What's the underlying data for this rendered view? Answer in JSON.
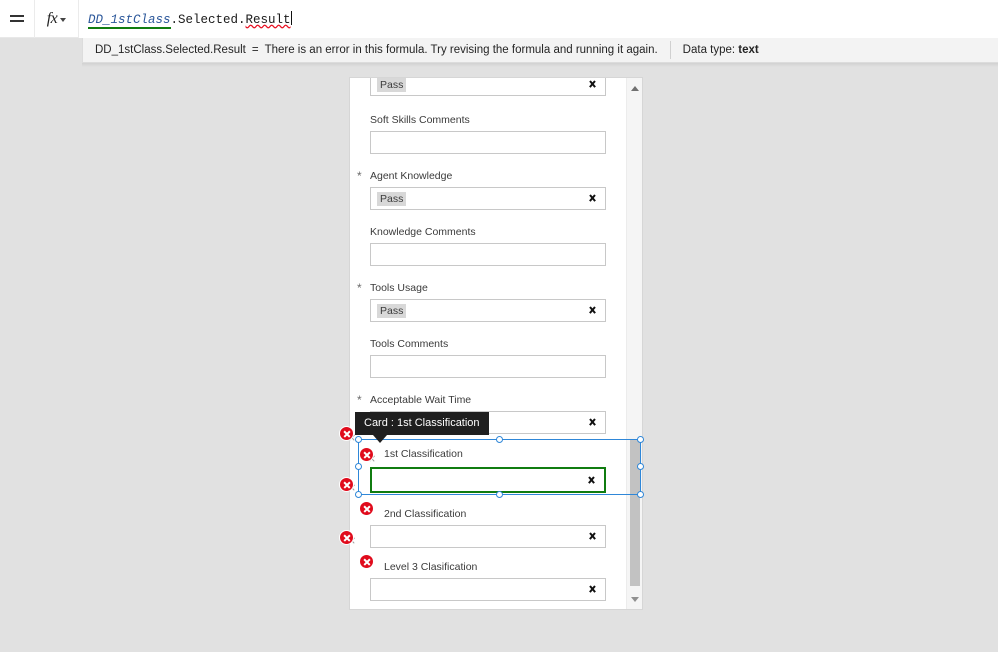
{
  "formula_bar": {
    "menu_icon": "hamburger-icon",
    "fx_label": "fx",
    "formula_token_name": "DD_1stClass",
    "formula_token_mid": ".Selected.",
    "formula_token_err": "Result"
  },
  "info_strip": {
    "formula_echo": "DD_1stClass.Selected.Result",
    "equals": "=",
    "message": "There is an error in this formula. Try revising the formula and running it again.",
    "datatype_label": "Data type:",
    "datatype_value": "text"
  },
  "tooltip": {
    "text": "Card : 1st Classification"
  },
  "form": {
    "fields": [
      {
        "label": "",
        "value": "Pass",
        "kind": "dropdown",
        "required": false
      },
      {
        "label": "Soft Skills Comments",
        "value": "",
        "kind": "text",
        "required": false
      },
      {
        "label": "Agent Knowledge",
        "value": "Pass",
        "kind": "dropdown",
        "required": true
      },
      {
        "label": "Knowledge Comments",
        "value": "",
        "kind": "text",
        "required": false
      },
      {
        "label": "Tools Usage",
        "value": "Pass",
        "kind": "dropdown",
        "required": true
      },
      {
        "label": "Tools Comments",
        "value": "",
        "kind": "text",
        "required": false
      },
      {
        "label": "Acceptable Wait Time",
        "value": "",
        "kind": "dropdown",
        "required": true
      },
      {
        "label": "1st Classification",
        "value": "",
        "kind": "dropdown",
        "required": false
      },
      {
        "label": "2nd Classification",
        "value": "",
        "kind": "dropdown",
        "required": false
      },
      {
        "label": "Level 3 Clasification",
        "value": "",
        "kind": "dropdown",
        "required": false
      }
    ]
  },
  "colors": {
    "canvas_bg": "#e1e1e1",
    "error_red": "#e00b1c",
    "selection_blue": "#2f87d8",
    "valid_green": "#107c10",
    "tooltip_bg": "#1f1f1f",
    "token_blue": "#2b579a"
  }
}
